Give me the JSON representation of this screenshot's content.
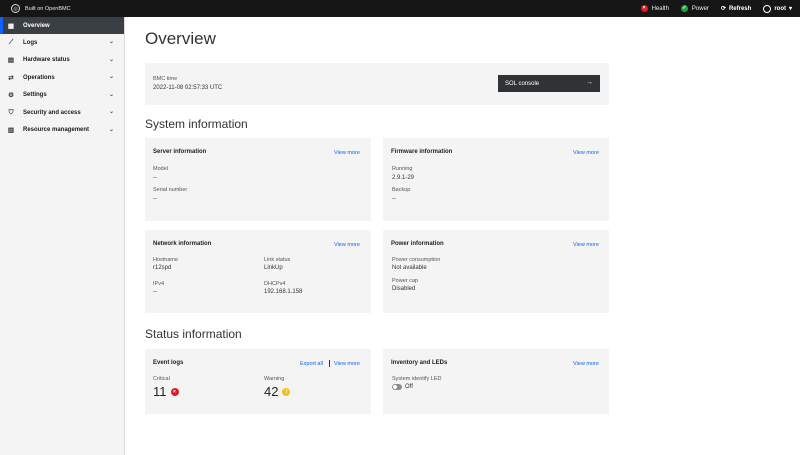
{
  "topbar": {
    "brand": "Built on OpenBMC",
    "health_label": "Health",
    "health_color": "#da1e28",
    "power_label": "Power",
    "power_color": "#24a148",
    "refresh_label": "Refresh",
    "user_label": "root"
  },
  "sidebar": {
    "items": [
      {
        "label": "Overview",
        "icon": "grid-icon",
        "active": true
      },
      {
        "label": "Logs",
        "icon": "chart-icon"
      },
      {
        "label": "Hardware status",
        "icon": "server-icon"
      },
      {
        "label": "Operations",
        "icon": "sliders-icon"
      },
      {
        "label": "Settings",
        "icon": "gear-icon"
      },
      {
        "label": "Security and access",
        "icon": "shield-icon"
      },
      {
        "label": "Resource management",
        "icon": "bars-icon"
      }
    ]
  },
  "main": {
    "title": "Overview",
    "bmc": {
      "label": "BMC time",
      "value": "2022-11-08 02:57:33 UTC",
      "sol_label": "SOL console"
    },
    "system_title": "System information",
    "server": {
      "title": "Server information",
      "view_more": "View more",
      "model_label": "Model",
      "model_value": "--",
      "serial_label": "Serial number",
      "serial_value": "--"
    },
    "firmware": {
      "title": "Firmware information",
      "view_more": "View more",
      "running_label": "Running",
      "running_value": "2.9.1-29",
      "backup_label": "Backup",
      "backup_value": "--"
    },
    "network": {
      "title": "Network information",
      "view_more": "View more",
      "hostname_label": "Hostname",
      "hostname_value": "r12spd",
      "link_label": "Link status",
      "link_value": "LinkUp",
      "ipv4_label": "IPv4",
      "ipv4_value": "--",
      "dhcp_label": "DHCPv4",
      "dhcp_value": "192.168.1.158"
    },
    "power": {
      "title": "Power information",
      "view_more": "View more",
      "consumption_label": "Power consumption",
      "consumption_value": "Not available",
      "cap_label": "Power cap",
      "cap_value": "Disabled"
    },
    "status_title": "Status information",
    "events": {
      "title": "Event logs",
      "export_all": "Export all",
      "view_more": "View more",
      "critical_label": "Critical",
      "critical_value": "11",
      "warning_label": "Warning",
      "warning_value": "42"
    },
    "inventory": {
      "title": "Inventory and LEDs",
      "view_more": "View more",
      "led_label": "System identify LED",
      "led_value": "Off"
    }
  }
}
